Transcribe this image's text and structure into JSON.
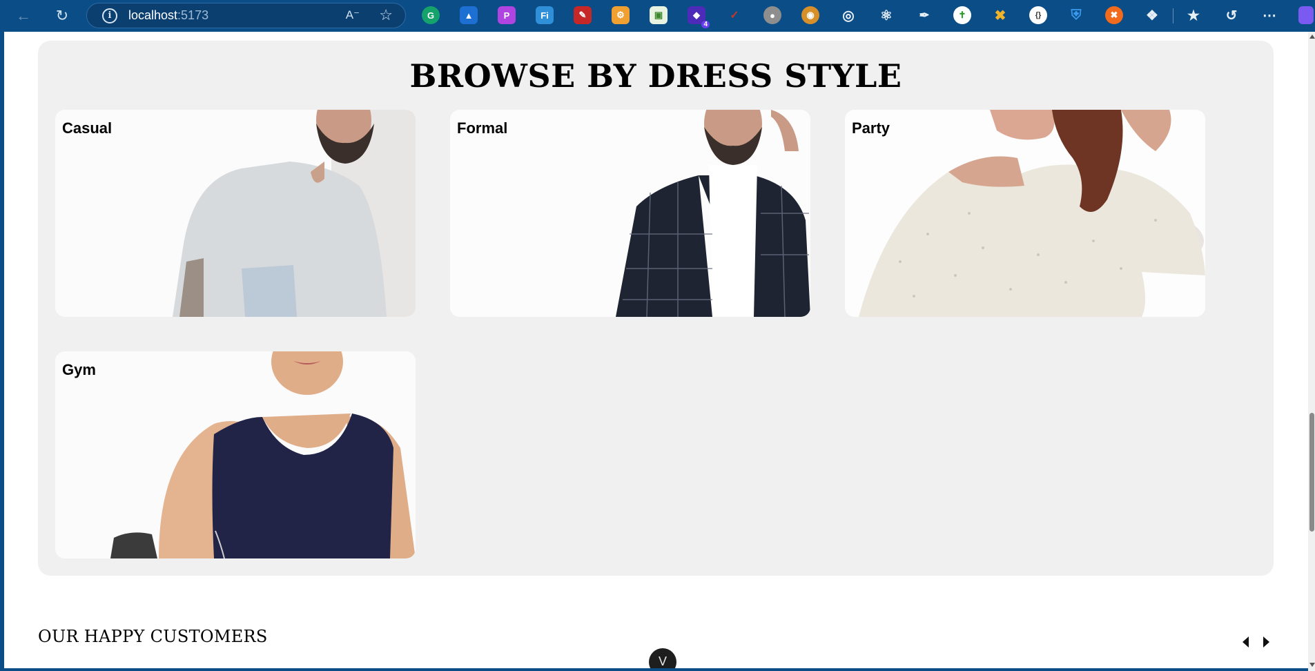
{
  "browser": {
    "url_host": "localhost",
    "url_port": ":5173",
    "extension_badge": "4"
  },
  "section": {
    "title": "BROWSE BY DRESS STYLE",
    "cards": [
      {
        "label": "Casual"
      },
      {
        "label": "Formal"
      },
      {
        "label": "Party"
      },
      {
        "label": "Gym"
      }
    ]
  },
  "customers": {
    "title": "OUR HAPPY CUSTOMERS"
  },
  "colors": {
    "chrome": "#0b4d86",
    "section_bg": "#f0f0f0",
    "card_bg": "#ffffff"
  }
}
